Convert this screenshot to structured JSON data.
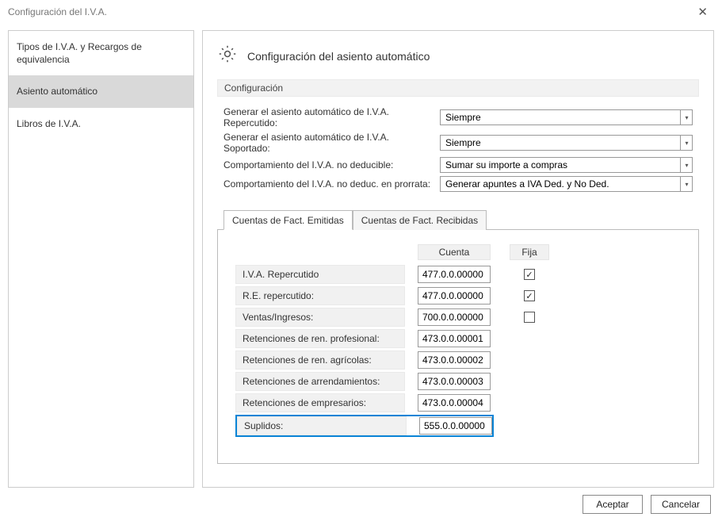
{
  "window": {
    "title": "Configuración del I.V.A."
  },
  "sidebar": {
    "items": [
      {
        "label": "Tipos de I.V.A. y Recargos de equivalencia"
      },
      {
        "label": "Asiento automático"
      },
      {
        "label": "Libros de I.V.A."
      }
    ],
    "selected_index": 1
  },
  "section": {
    "title": "Configuración del asiento automático"
  },
  "group_label": "Configuración",
  "form": {
    "rows": [
      {
        "label": "Generar el asiento automático de I.V.A. Repercutido:",
        "value": "Siempre"
      },
      {
        "label": "Generar el asiento automático de I.V.A. Soportado:",
        "value": "Siempre"
      },
      {
        "label": "Comportamiento del I.V.A. no deducible:",
        "value": "Sumar su importe a compras"
      },
      {
        "label": "Comportamiento del I.V.A. no deduc. en prorrata:",
        "value": "Generar apuntes a IVA Ded. y No Ded."
      }
    ]
  },
  "tabs": {
    "items": [
      {
        "label": "Cuentas de Fact. Emitidas"
      },
      {
        "label": "Cuentas de Fact. Recibidas"
      }
    ],
    "active_index": 0,
    "headers": {
      "cuenta": "Cuenta",
      "fija": "Fija"
    },
    "accounts": [
      {
        "label": "I.V.A. Repercutido",
        "cuenta": "477.0.0.00000",
        "fija": true,
        "has_fija": true,
        "highlight": false
      },
      {
        "label": "R.E. repercutido:",
        "cuenta": "477.0.0.00000",
        "fija": true,
        "has_fija": true,
        "highlight": false
      },
      {
        "label": "Ventas/Ingresos:",
        "cuenta": "700.0.0.00000",
        "fija": false,
        "has_fija": true,
        "highlight": false
      },
      {
        "label": "Retenciones de ren. profesional:",
        "cuenta": "473.0.0.00001",
        "fija": false,
        "has_fija": false,
        "highlight": false
      },
      {
        "label": "Retenciones de ren. agrícolas:",
        "cuenta": "473.0.0.00002",
        "fija": false,
        "has_fija": false,
        "highlight": false
      },
      {
        "label": "Retenciones de arrendamientos:",
        "cuenta": "473.0.0.00003",
        "fija": false,
        "has_fija": false,
        "highlight": false
      },
      {
        "label": "Retenciones de empresarios:",
        "cuenta": "473.0.0.00004",
        "fija": false,
        "has_fija": false,
        "highlight": false
      },
      {
        "label": "Suplidos:",
        "cuenta": "555.0.0.00000",
        "fija": false,
        "has_fija": false,
        "highlight": true
      }
    ]
  },
  "footer": {
    "accept": "Aceptar",
    "cancel": "Cancelar"
  }
}
